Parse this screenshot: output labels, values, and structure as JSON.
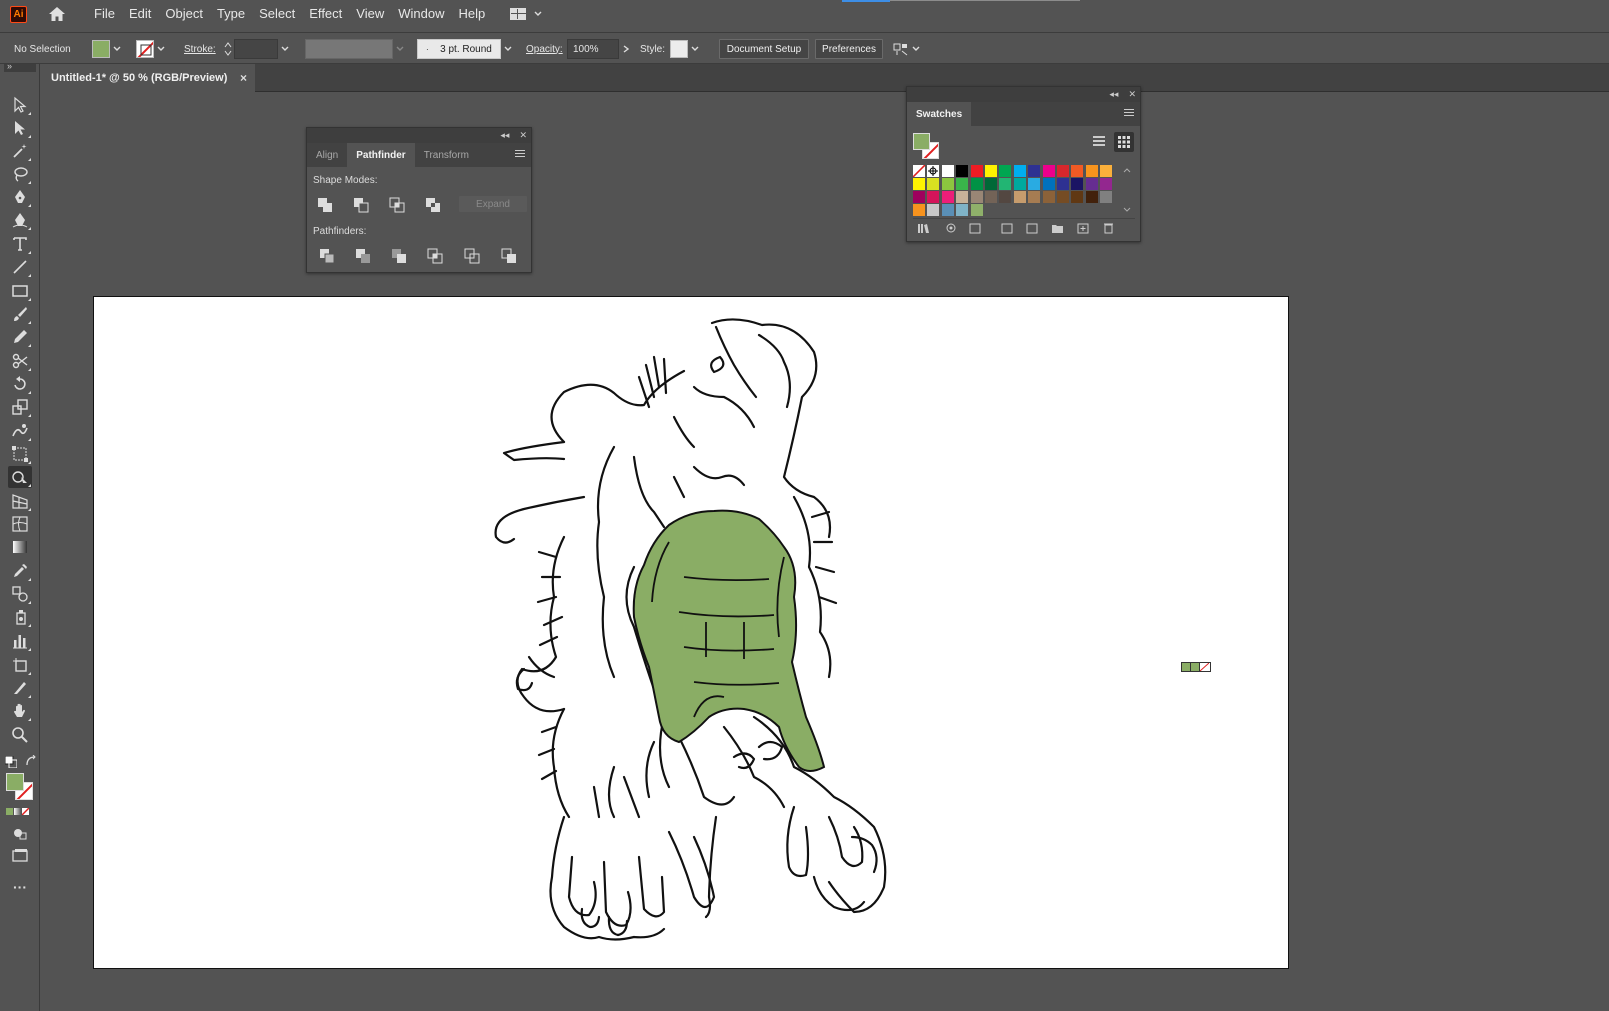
{
  "app": {
    "logo_text": "Ai"
  },
  "menu": [
    "File",
    "Edit",
    "Object",
    "Type",
    "Select",
    "Effect",
    "View",
    "Window",
    "Help"
  ],
  "control": {
    "selection": "No Selection",
    "stroke_label": "Stroke:",
    "brush": "3 pt. Round",
    "opacity_label": "Opacity:",
    "opacity_value": "100%",
    "style_label": "Style:",
    "doc_setup": "Document Setup",
    "preferences": "Preferences"
  },
  "tab": {
    "title": "Untitled-1* @ 50 % (RGB/Preview)",
    "close": "×"
  },
  "pathfinder_panel": {
    "tabs": [
      "Align",
      "Pathfinder",
      "Transform"
    ],
    "shape_modes_label": "Shape Modes:",
    "expand_label": "Expand",
    "pathfinders_label": "Pathfinders:"
  },
  "swatches_panel": {
    "tab": "Swatches",
    "rows": [
      [
        "none",
        "reg",
        "#ffffff",
        "#000000",
        "#ed1c24",
        "#fff200",
        "#00a651",
        "#00aeef",
        "#2e3192",
        "#ec008c",
        "#d7272c",
        "#f15a24",
        "#f7941d",
        "#fbb03b"
      ],
      [
        "#fff200",
        "#d9e021",
        "#8cc63f",
        "#39b54a",
        "#009245",
        "#006837",
        "#22b573",
        "#00a99d",
        "#29abe2",
        "#0071bc",
        "#2e3192",
        "#1b1464",
        "#662d91",
        "#93278f"
      ],
      [
        "#9e005d",
        "#d4145a",
        "#ed1e79",
        "#c7b299",
        "#998675",
        "#736357",
        "#534741",
        "#c69c6d",
        "#a67c52",
        "#8c6239",
        "#754c24",
        "#603813",
        "#42210b",
        "#808080"
      ],
      [
        "#f7931e",
        "#c8c8c8",
        "#5a8fb6",
        "#7fb3c7",
        "#8fb06a"
      ]
    ]
  },
  "colors": {
    "fill": "#8aad65",
    "accent": "#3d8ee6"
  }
}
